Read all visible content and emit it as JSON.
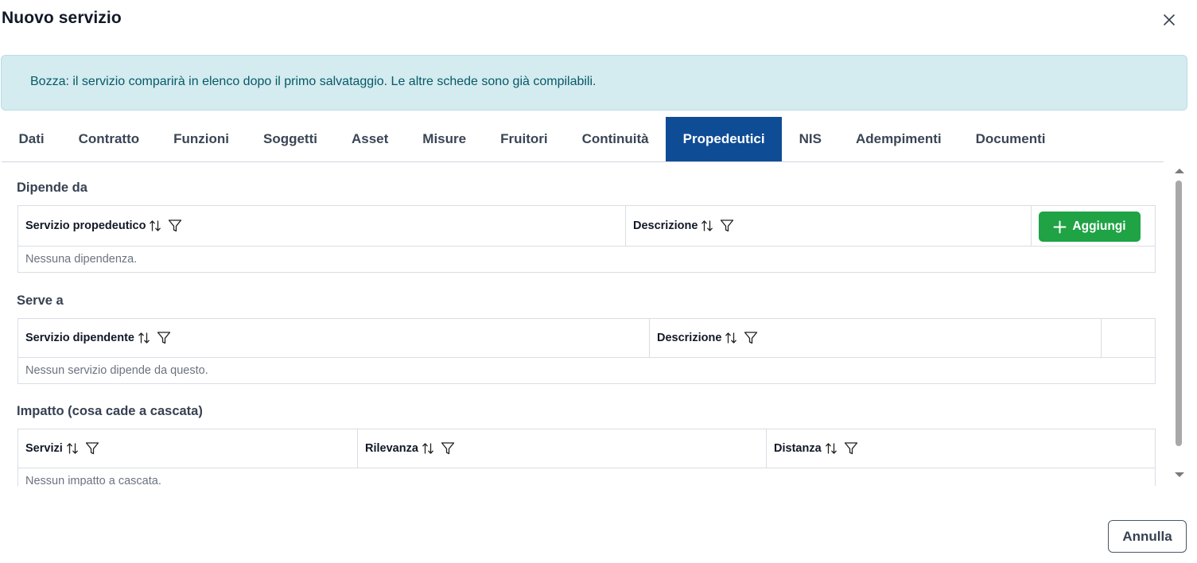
{
  "dialog": {
    "title": "Nuovo servizio"
  },
  "alert": {
    "text": "Bozza: il servizio comparirà in elenco dopo il primo salvataggio. Le altre schede sono già compilabili."
  },
  "tabs": [
    {
      "label": "Dati"
    },
    {
      "label": "Contratto"
    },
    {
      "label": "Funzioni"
    },
    {
      "label": "Soggetti"
    },
    {
      "label": "Asset"
    },
    {
      "label": "Misure"
    },
    {
      "label": "Fruitori"
    },
    {
      "label": "Continuità"
    },
    {
      "label": "Propedeutici",
      "active": true
    },
    {
      "label": "NIS"
    },
    {
      "label": "Adempimenti"
    },
    {
      "label": "Documenti"
    }
  ],
  "sections": {
    "dipende": {
      "title": "Dipende da",
      "columns": [
        "Servizio propedeutico",
        "Descrizione"
      ],
      "add_label": "Aggiungi",
      "empty": "Nessuna dipendenza."
    },
    "serve": {
      "title": "Serve a",
      "columns": [
        "Servizio dipendente",
        "Descrizione"
      ],
      "empty": "Nessun servizio dipende da questo."
    },
    "impatto": {
      "title": "Impatto (cosa cade a cascata)",
      "columns": [
        "Servizi",
        "Rilevanza",
        "Distanza"
      ],
      "empty": "Nessun impatto a cascata."
    }
  },
  "footer": {
    "cancel_label": "Annulla"
  },
  "colors": {
    "active_tab": "#0f4c96",
    "add_button": "#1fa345",
    "alert_bg": "#d4ebf0",
    "alert_text": "#055a66"
  }
}
